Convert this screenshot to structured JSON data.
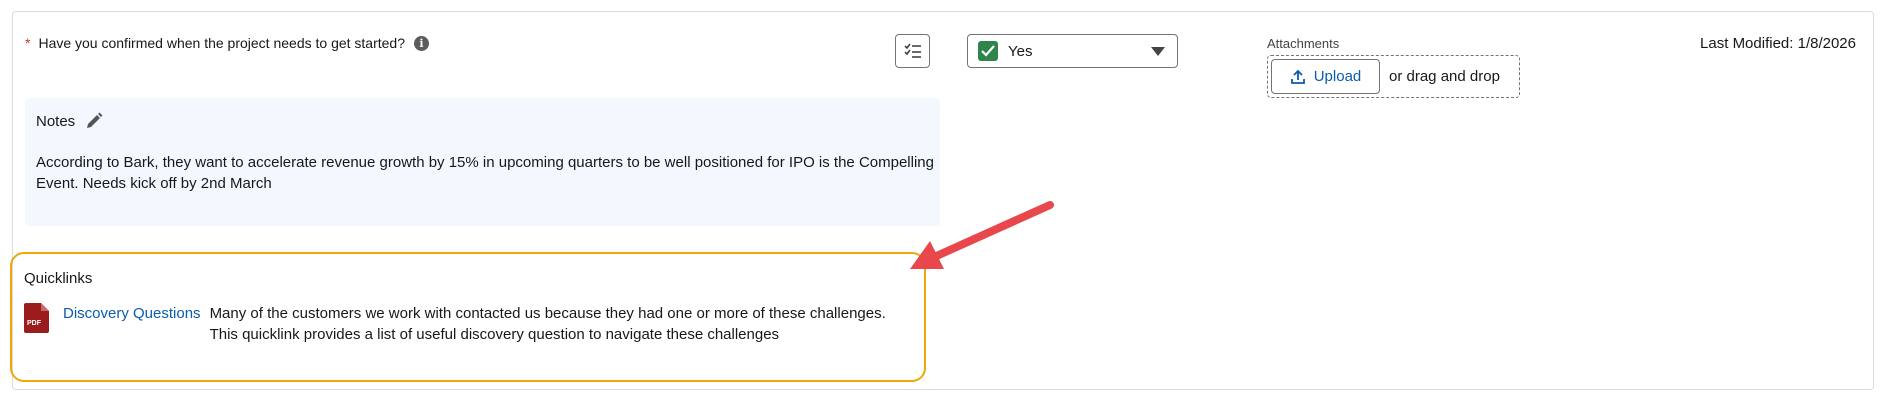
{
  "question": {
    "required_marker": "*",
    "text": "Have you confirmed when the project needs to get started?",
    "info_icon_glyph": "i"
  },
  "status_select": {
    "value": "Yes",
    "check_color": "#2e844a"
  },
  "attachments": {
    "label": "Attachments",
    "upload_label": "Upload",
    "drag_text": "or drag and drop"
  },
  "last_modified": "Last Modified: 1/8/2026",
  "notes": {
    "heading": "Notes",
    "body": "According to Bark, they want to  accelerate revenue growth by 15% in upcoming quarters to be well positioned for IPO is the Compelling Event. Needs kick off by 2nd March"
  },
  "quicklinks": {
    "title": "Quicklinks",
    "items": [
      {
        "icon": "pdf-icon",
        "icon_label": "PDF",
        "link": "Discovery Questions",
        "description": "Many of the customers we work with contacted us because they had one or more of these challenges. This quicklink provides a list of useful discovery question to navigate these challenges"
      }
    ],
    "highlight_color": "#f0a70a"
  },
  "annotation": {
    "arrow_color": "#e8484b"
  }
}
